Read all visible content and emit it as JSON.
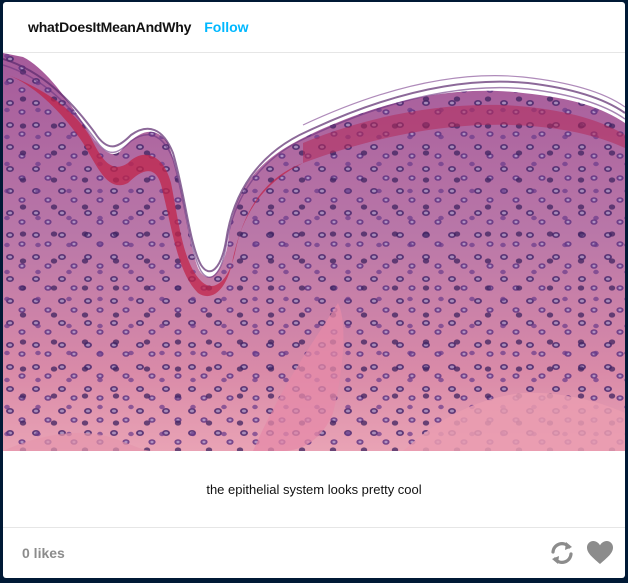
{
  "post": {
    "author": "whatDoesItMeanAndWhy",
    "follow_label": "Follow",
    "caption": "the epithelial system looks pretty cool",
    "notes": "0 likes"
  },
  "icons": {
    "reblog": "reblog-icon",
    "like": "heart-icon"
  },
  "colors": {
    "background": "#001935",
    "follow": "#00b8ff",
    "icon": "#8c8c8c",
    "tissue_pink": "#d98aa8",
    "tissue_purple": "#8a4f8f",
    "stain_red": "#c0244a"
  }
}
